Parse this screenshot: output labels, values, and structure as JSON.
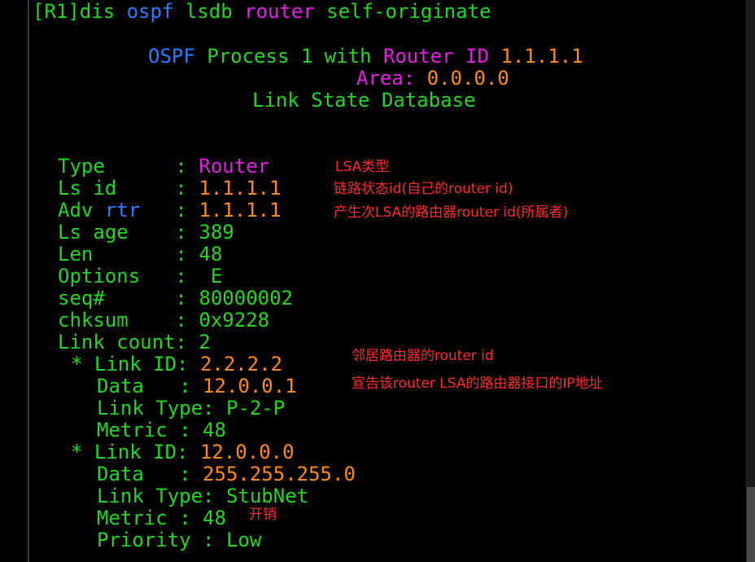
{
  "colors": {
    "background": "#000000",
    "text": "#25d425",
    "keyword": "#2d7bff",
    "highlight": "#e31ee3",
    "value": "#ff8a1a",
    "annotation": "#ff2a2a"
  },
  "command": {
    "prompt": "[R1]",
    "cmd1": "dis",
    "cmd2": "ospf",
    "cmd3": "lsdb",
    "cmd4": "router",
    "cmd5": "self-originate"
  },
  "header": {
    "ospf": "OSPF",
    "process_text": "Process 1 with",
    "router": "Router",
    "id_label": "ID",
    "router_id": "1.1.1.1",
    "area_label": "Area:",
    "area_value": "0.0.0.0",
    "db_title": "Link State Database"
  },
  "lsa": {
    "type": {
      "label": "Type      :",
      "value": "Router"
    },
    "ls_id": {
      "label": "Ls id     :",
      "value": "1.1.1.1"
    },
    "adv_rtr": {
      "label1": "Adv",
      "label2": "rtr",
      "sep": ":",
      "value": "1.1.1.1"
    },
    "ls_age": {
      "label": "Ls age    :",
      "value": "389"
    },
    "len": {
      "label": "Len       :",
      "value": "48"
    },
    "options": {
      "label": "Options   :",
      "value": "E"
    },
    "seq": {
      "label": "seq#      :",
      "value": "80000002"
    },
    "chksum": {
      "label": "chksum    :",
      "value": "0x9228"
    },
    "link_count": {
      "label": "Link count:",
      "value": "2"
    }
  },
  "links": [
    {
      "link_id_label": "* Link ID:",
      "link_id": "2.2.2.2",
      "data_label": "Data   :",
      "data": "12.0.0.1",
      "type_label": "Link Type:",
      "type": "P-2-P",
      "metric_label": "Metric :",
      "metric": "48"
    },
    {
      "link_id_label": "* Link ID:",
      "link_id": "12.0.0.0",
      "data_label": "Data   :",
      "data": "255.255.255.0",
      "type_label": "Link Type:",
      "type": "StubNet",
      "metric_label": "Metric :",
      "metric": "48",
      "priority_label": "Priority :",
      "priority": "Low"
    }
  ],
  "annotations": {
    "lsa_type": "LSA类型",
    "ls_id": "链路状态id(自己的router id)",
    "adv_rtr": "产生次LSA的路由器router id(所属者)",
    "link_id": "邻居路由器的router id",
    "data": "宣告该router LSA的路由器接口的IP地址",
    "metric": "开销"
  }
}
